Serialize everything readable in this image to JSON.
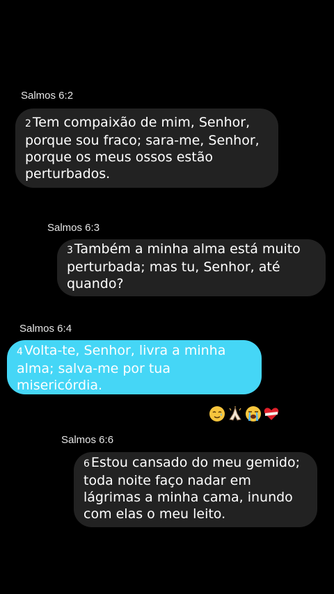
{
  "messages": [
    {
      "label": "Salmos 6:2",
      "verse_number": "2",
      "text": "Tem compaixão de mim, Senhor, porque sou fraco; sara-me, Senhor, porque os meus ossos estão perturbados."
    },
    {
      "label": "Salmos 6:3",
      "verse_number": "3",
      "text": "Também a minha alma está muito perturbada; mas tu, Senhor, até quando?"
    },
    {
      "label": "Salmos 6:4",
      "verse_number": "4",
      "text": "Volta-te, Senhor, livra a minha alma; salva-me por tua misericórdia."
    },
    {
      "label": "Salmos 6:6",
      "verse_number": "6",
      "text": "Estou cansado do meu gemido; toda noite faço nadar em lágrimas a minha cama, inundo com elas o meu leito."
    }
  ],
  "reaction_emojis": [
    "smiling-face-with-tear-icon",
    "praying-hands-icon",
    "loudly-crying-face-icon",
    "bandaged-heart-icon"
  ],
  "colors": {
    "background": "#000000",
    "bubble": "#222222",
    "highlight_bubble": "#45d6f6",
    "text": "#ffffff"
  }
}
